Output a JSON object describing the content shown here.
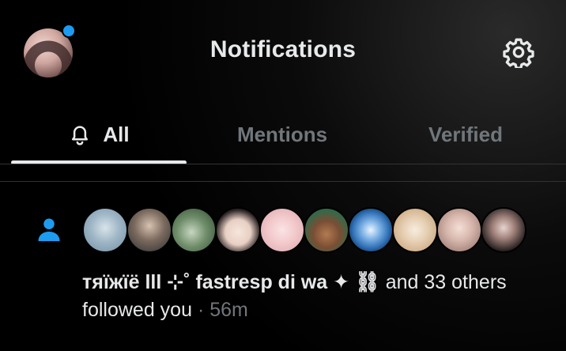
{
  "header": {
    "title": "Notifications",
    "unread_dot_color": "#1d9bf0",
    "avatar_icon": "user-avatar",
    "settings_icon": "gear-icon"
  },
  "tabs": [
    {
      "label": "All",
      "active": true,
      "icon": "bell-icon"
    },
    {
      "label": "Mentions",
      "active": false
    },
    {
      "label": "Verified",
      "active": false
    }
  ],
  "notification": {
    "type_icon": "person-icon",
    "type_icon_color": "#1d9bf0",
    "names": "тяїжїё lll ⊹˚ fastresp di wa ✦ ⛓",
    "and_others": "and 33",
    "suffix": "others followed you",
    "separator": "·",
    "time": "56m"
  },
  "colors": {
    "background": "#000000",
    "text_primary": "#e7e9ea",
    "text_secondary": "#71767b",
    "accent": "#1d9bf0",
    "divider": "#2f3336"
  }
}
